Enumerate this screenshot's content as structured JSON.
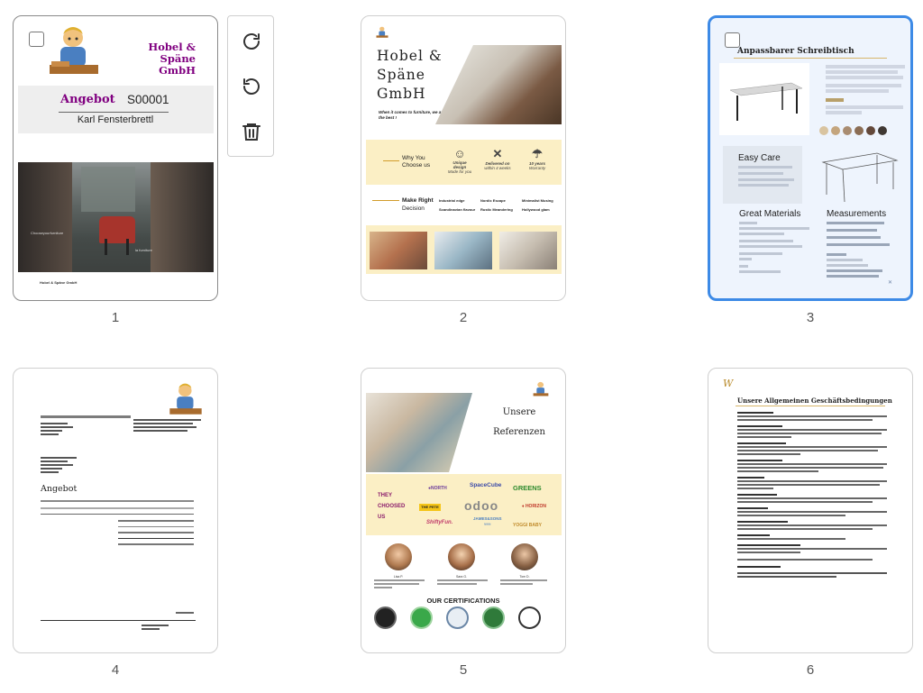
{
  "toolbar": {
    "rotate_right": "rotate-clockwise",
    "rotate_left": "rotate-counterclockwise",
    "delete": "trash"
  },
  "pages": [
    {
      "number": "1",
      "company": [
        "Hobel &",
        "Späne",
        "GmbH"
      ],
      "quote_label": "Angebot",
      "quote_number": "S00001",
      "customer": "Karl Fensterbrettl",
      "footer": "Hobel & Späne GmbH"
    },
    {
      "number": "2",
      "company": [
        "Hobel &",
        "Späne",
        "GmbH"
      ],
      "tagline": "When it comes to furniture, we are the best !",
      "why_label": [
        "Why You",
        "Choose us"
      ],
      "features": [
        {
          "title": "Unique design",
          "sub": "Made for you"
        },
        {
          "title": "Delivered on",
          "sub": "within 4 weeks"
        },
        {
          "title": "10 years",
          "sub": "Warranty"
        }
      ],
      "decision_label": [
        "Make Right",
        "Decision"
      ],
      "decision_items": [
        "Industrial edge",
        "Nordic Escape",
        "Minimalist Musing",
        "Scandinavian flavour",
        "Rustic Meandering",
        "Hollywood glam"
      ]
    },
    {
      "number": "3",
      "title": "Anpassbarer Schreibtisch",
      "easy_care": "Easy Care",
      "materials": "Great Materials",
      "measurements": "Measurements"
    },
    {
      "number": "4",
      "quote_title": "Angebot"
    },
    {
      "number": "5",
      "title": [
        "Unsere",
        "Referenzen"
      ],
      "they_choosed": [
        "THEY",
        "CHOOSED",
        "US"
      ],
      "logos": [
        "SpaceCube",
        "odoo",
        "GREENS",
        "YOGGI BABY"
      ],
      "certifications": "OUR CERTIFICATIONS",
      "people": [
        "Lisa P.",
        "Sara G.",
        "Tom D."
      ]
    },
    {
      "number": "6",
      "title": "Unsere Allgemeinen Geschäftsbedingungen"
    }
  ]
}
